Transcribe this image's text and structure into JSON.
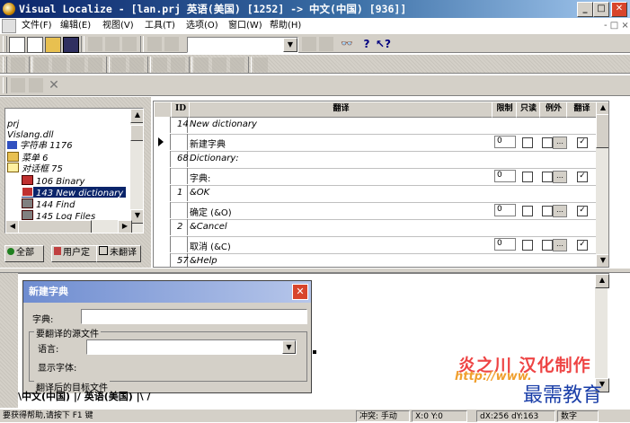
{
  "title_bar": {
    "text": "Visual Localize - [lan.prj 英语(美国) [1252] -> 中文(中国) [936]]",
    "minimize": "_",
    "maximize": "□",
    "close": "✕"
  },
  "menu": {
    "items": [
      "文件(F)",
      "编辑(E)",
      "视图(V)",
      "工具(T)",
      "选项(O)",
      "窗口(W)",
      "帮助(H)"
    ],
    "right_controls": "- □ ×"
  },
  "tree": {
    "lines": [
      "prj",
      "Vislang.dll",
      "字符串 1176",
      "菜单 6",
      "对话框 75",
      "106 Binary",
      "143 New dictionary",
      "144 Find",
      "145 Log Files"
    ]
  },
  "left_tabs": [
    "全部",
    "用户定",
    "未翻译"
  ],
  "grid": {
    "headers": {
      "id": "ID",
      "translation": "翻译",
      "limit": "限制",
      "readonly": "只读",
      "exception": "例外",
      "translate": "翻译"
    },
    "rows": [
      {
        "id": "14",
        "source": "New dictionary",
        "target": "新建字典",
        "limit": "0"
      },
      {
        "id": "68",
        "source": "Dictionary:",
        "target": "字典:",
        "limit": "0"
      },
      {
        "id": "1",
        "source": "&OK",
        "target": "确定 (&O)",
        "limit": "0"
      },
      {
        "id": "2",
        "source": "&Cancel",
        "target": "取消 (&C)",
        "limit": "0"
      },
      {
        "id": "57",
        "source": "&Help",
        "target": "",
        "limit": ""
      }
    ]
  },
  "dialog": {
    "title": "新建字典",
    "close": "✕",
    "dictionary_label": "字典:",
    "group_source": "要翻译的源文件",
    "language_label": "语言:",
    "display_font_label": "显示字体:",
    "group_target": "翻译后的目标文件"
  },
  "bottom_tabs": "\\中文(中国) |/ 英语(美国) |\\ /",
  "status": {
    "help": "要获得帮助,请按下 F1 键",
    "conflict": "冲突: 手动",
    "pos": "X:0 Y:0",
    "delta": "dX:256 dY:163",
    "numlock": "数字"
  },
  "watermark": {
    "line1": "炎之川 汉化制作",
    "line2": "http://www.",
    "line3": "最需教育"
  }
}
